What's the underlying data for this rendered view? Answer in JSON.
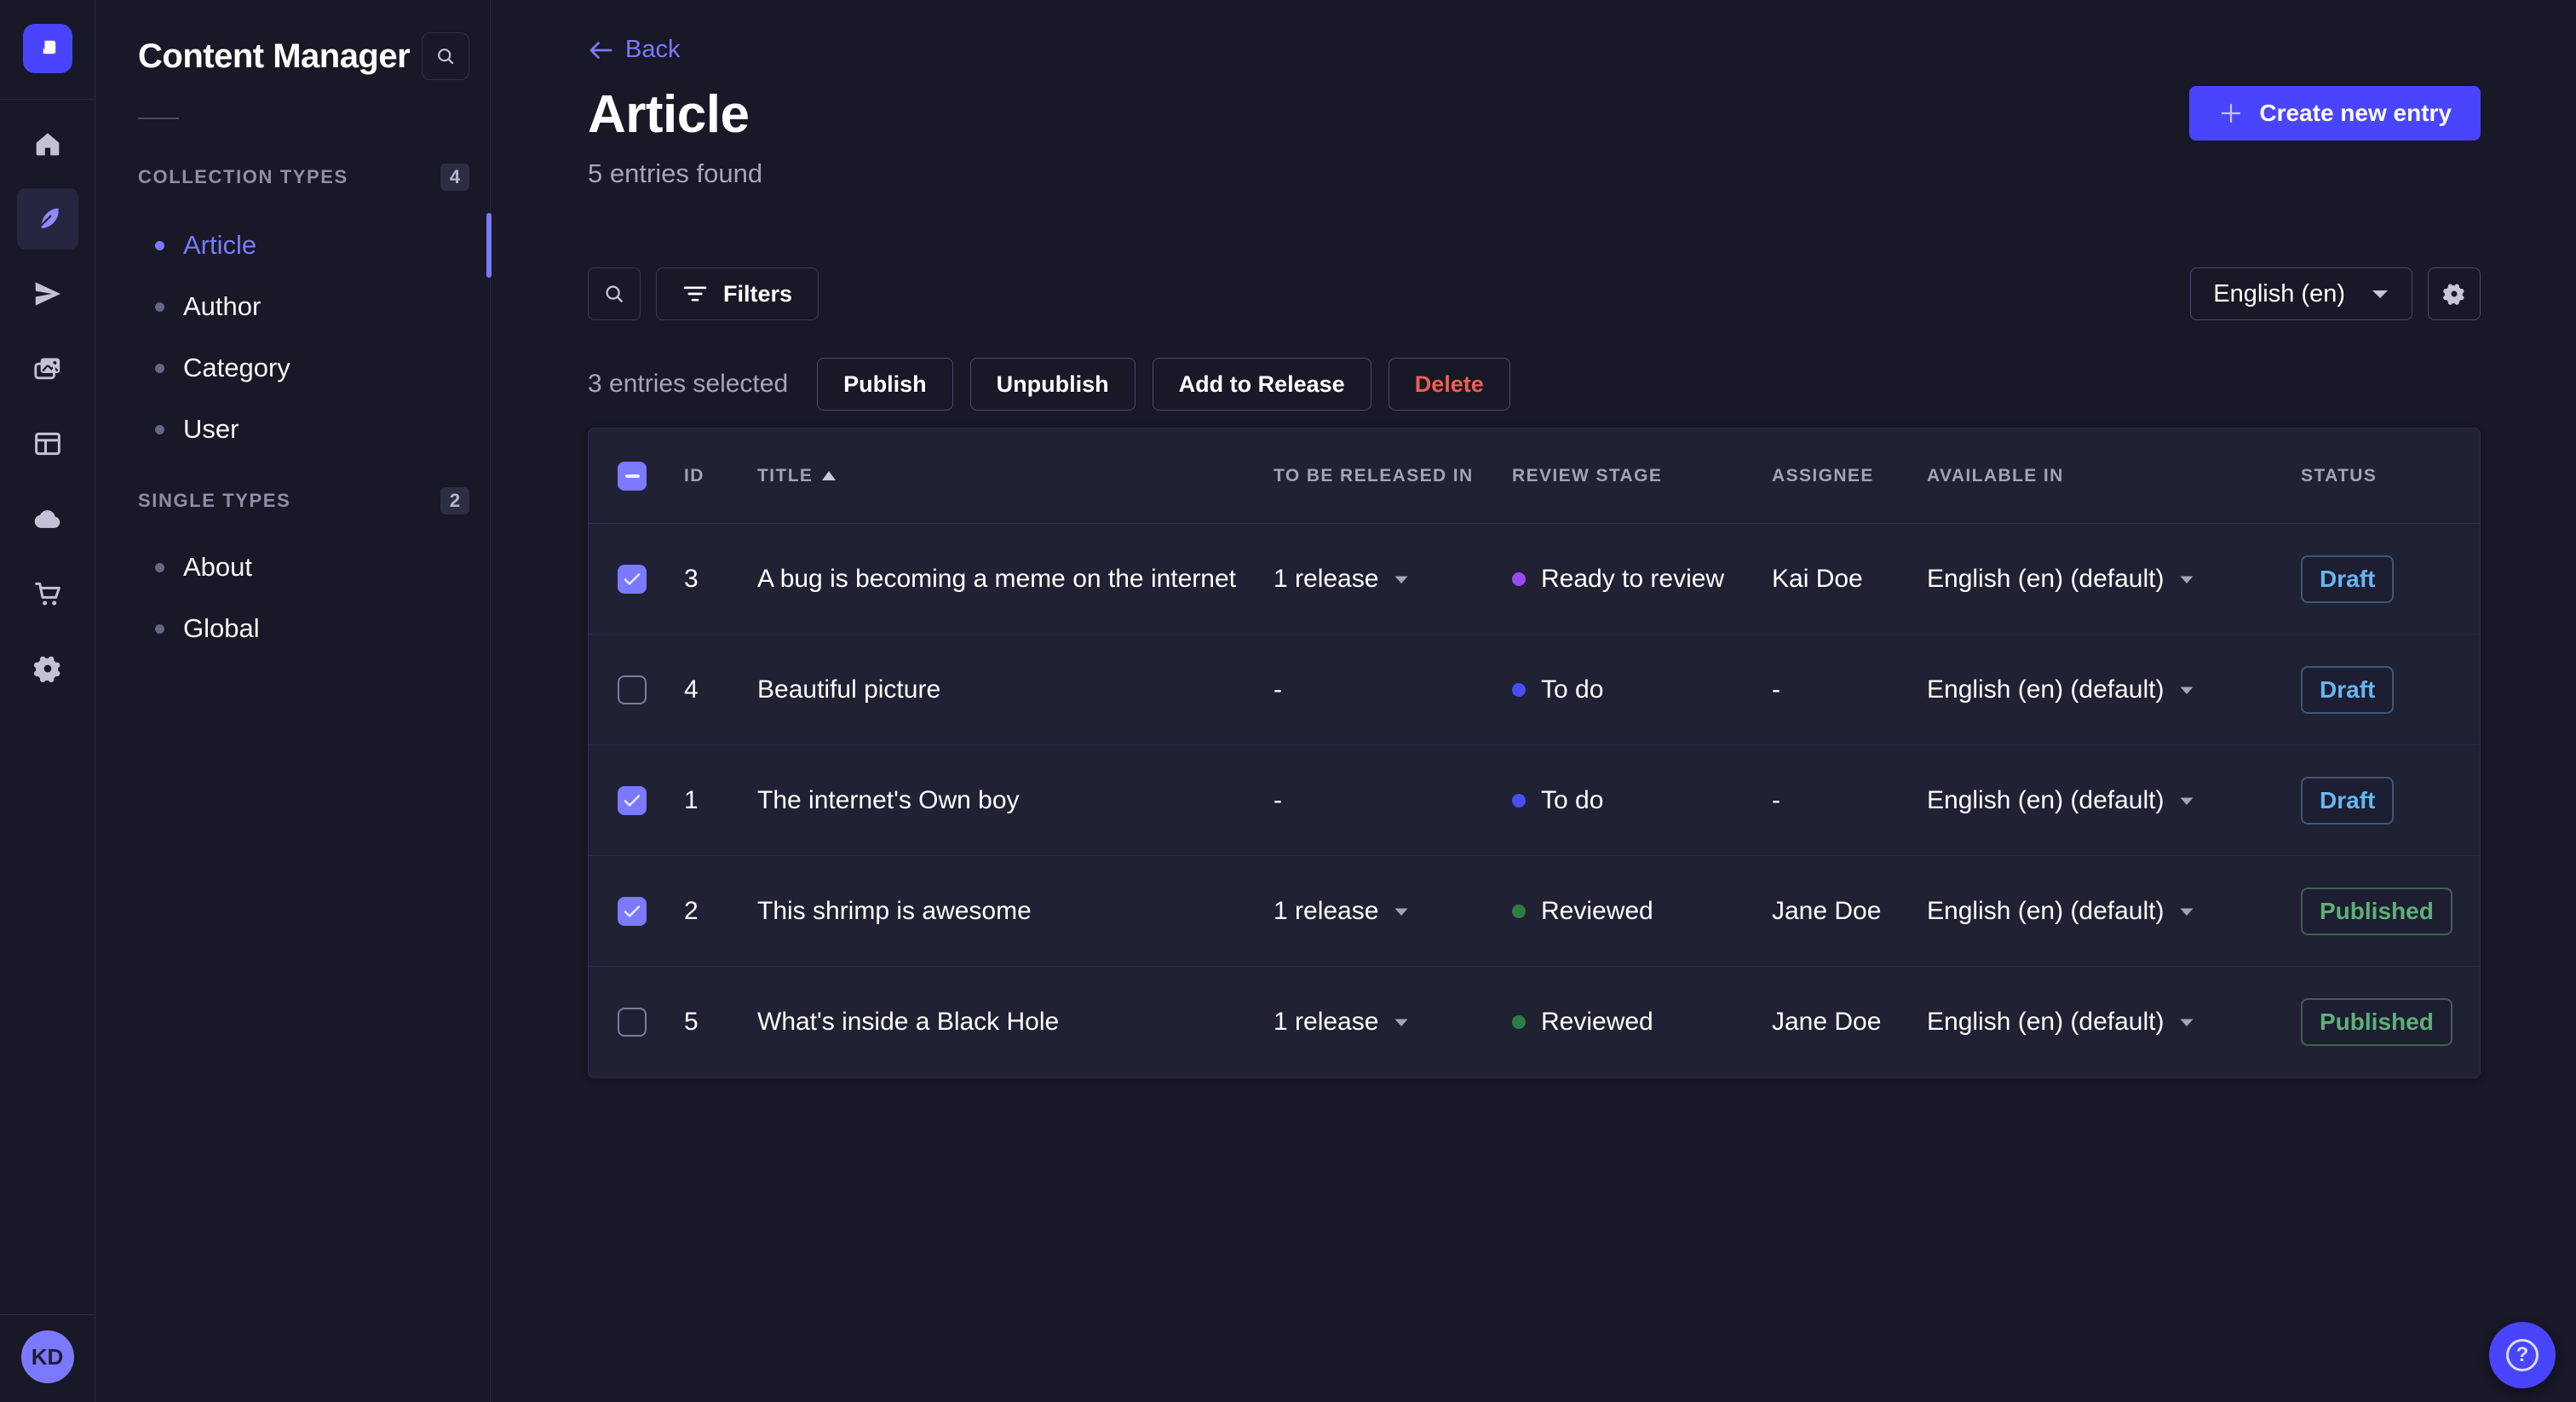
{
  "rail": {
    "icons": [
      "strapi-logo",
      "home",
      "content-manager",
      "releases",
      "media-library",
      "content-type-builder",
      "cloud",
      "marketplace",
      "settings"
    ],
    "avatar_initials": "KD"
  },
  "sidebar": {
    "title": "Content Manager",
    "sections": [
      {
        "label": "COLLECTION TYPES",
        "count": "4",
        "items": [
          {
            "label": "Article"
          },
          {
            "label": "Author"
          },
          {
            "label": "Category"
          },
          {
            "label": "User"
          }
        ]
      },
      {
        "label": "SINGLE TYPES",
        "count": "2",
        "items": [
          {
            "label": "About"
          },
          {
            "label": "Global"
          }
        ]
      }
    ]
  },
  "header": {
    "back_label": "Back",
    "title": "Article",
    "subtitle": "5 entries found",
    "create_label": "Create new entry"
  },
  "toolbar": {
    "filters_label": "Filters",
    "locale_value": "English (en)"
  },
  "selection": {
    "text": "3 entries selected",
    "publish_label": "Publish",
    "unpublish_label": "Unpublish",
    "add_to_release_label": "Add to Release",
    "delete_label": "Delete"
  },
  "table": {
    "columns": {
      "id": "ID",
      "title": "TITLE",
      "released": "TO BE RELEASED IN",
      "stage": "REVIEW STAGE",
      "assignee": "ASSIGNEE",
      "available": "AVAILABLE IN",
      "status": "STATUS"
    },
    "rows": [
      {
        "checked": true,
        "id": "3",
        "title": "A bug is becoming a meme on the internet",
        "release": "1 release",
        "stage": "Ready to review",
        "assignee": "Kai Doe",
        "locale": "English (en) (default)",
        "status": "Draft"
      },
      {
        "checked": false,
        "id": "4",
        "title": "Beautiful picture",
        "release": "-",
        "stage": "To do",
        "assignee": "-",
        "locale": "English (en) (default)",
        "status": "Draft"
      },
      {
        "checked": true,
        "id": "1",
        "title": "The internet's Own boy",
        "release": "-",
        "stage": "To do",
        "assignee": "-",
        "locale": "English (en) (default)",
        "status": "Draft"
      },
      {
        "checked": true,
        "id": "2",
        "title": "This shrimp is awesome",
        "release": "1 release",
        "stage": "Reviewed",
        "assignee": "Jane Doe",
        "locale": "English (en) (default)",
        "status": "Published"
      },
      {
        "checked": false,
        "id": "5",
        "title": "What's inside a Black Hole",
        "release": "1 release",
        "stage": "Reviewed",
        "assignee": "Jane Doe",
        "locale": "English (en) (default)",
        "status": "Published"
      }
    ]
  },
  "help": {
    "icon_text": "?"
  },
  "colors": {
    "primary": "#4945ff",
    "primary_light": "#7b79ff",
    "danger": "#ee5e52",
    "draft_text": "#66b7f1",
    "published_text": "#5cb176",
    "stage_ready": "#9a4bf2",
    "stage_todo": "#4550f7",
    "stage_reviewed": "#2e7d47",
    "page_bg": "#181826",
    "card_bg": "#212134"
  }
}
